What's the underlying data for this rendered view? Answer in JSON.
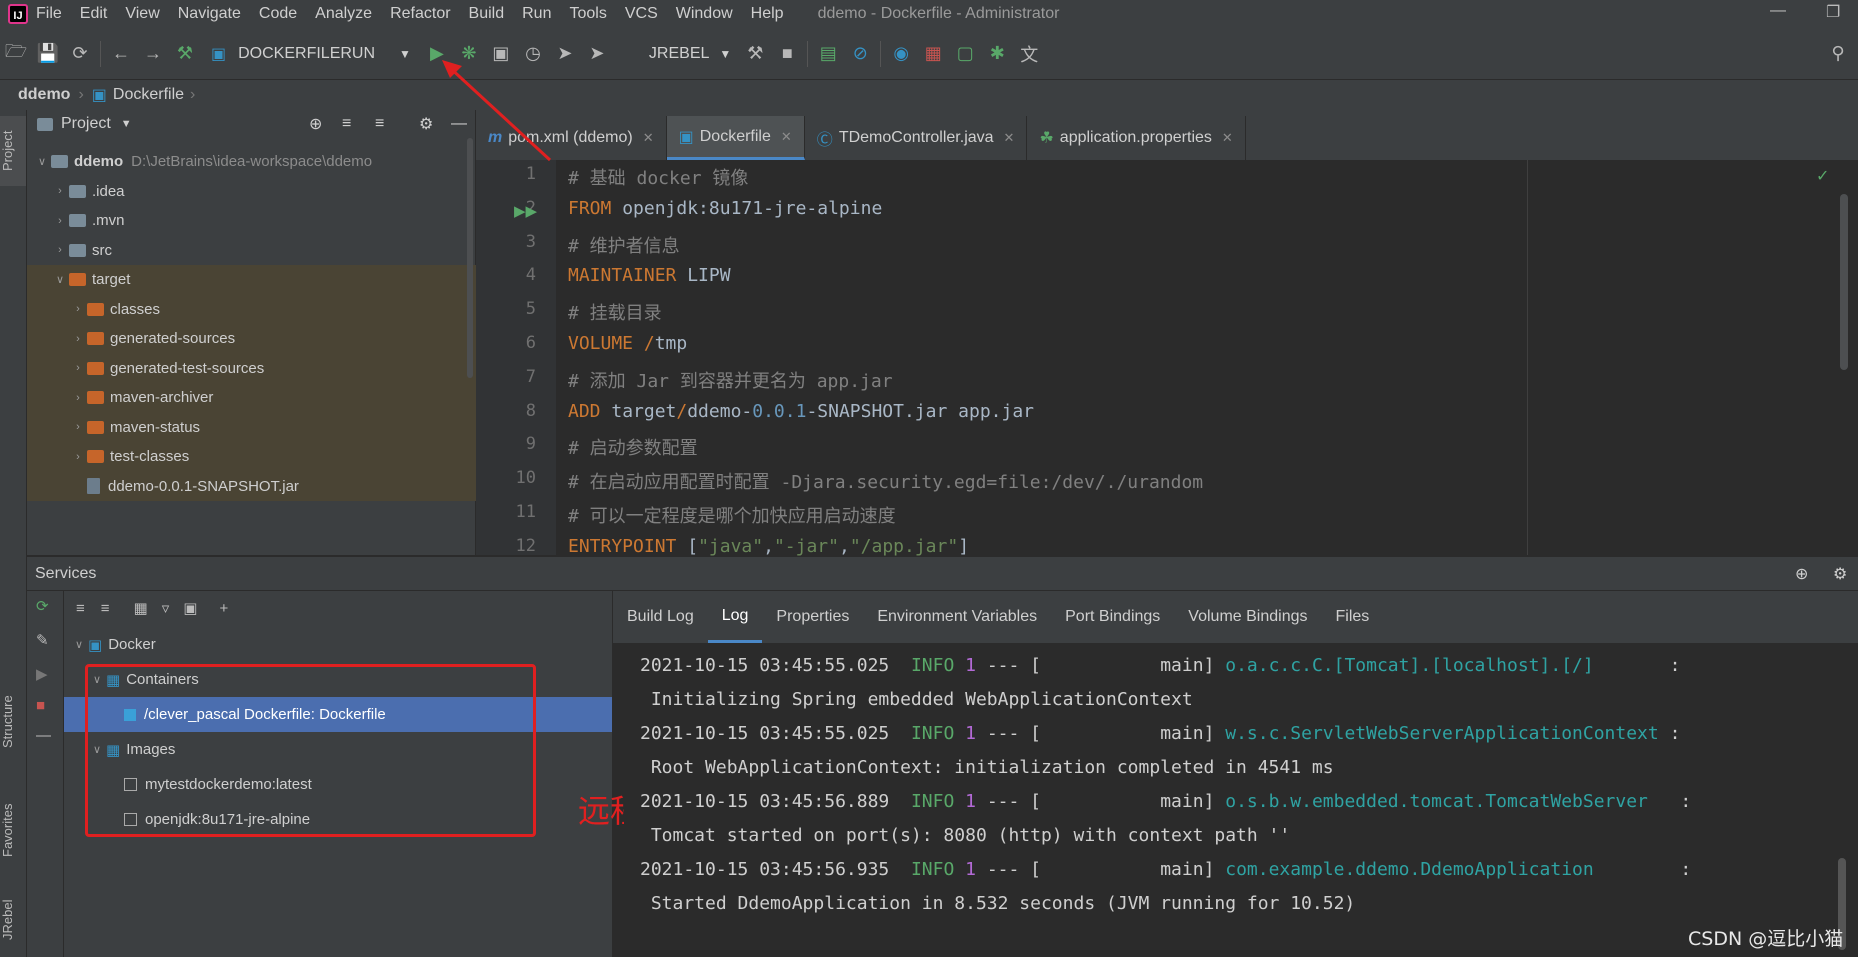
{
  "menubar": {
    "items": [
      "File",
      "Edit",
      "View",
      "Navigate",
      "Code",
      "Analyze",
      "Refactor",
      "Build",
      "Run",
      "Tools",
      "VCS",
      "Window",
      "Help"
    ],
    "window_title": "ddemo - Dockerfile - Administrator"
  },
  "toolbar": {
    "run_config": "DOCKERFILERUN",
    "jrebel_config": "JREBEL"
  },
  "breadcrumb": {
    "project": "ddemo",
    "file": "Dockerfile"
  },
  "left_strip": {
    "project_tab": "Project",
    "structure_tab": "Structure",
    "favorites_tab": "Favorites",
    "jrebel_tab": "JRebel"
  },
  "project": {
    "header": "Project",
    "tree": [
      {
        "label": "ddemo",
        "path": "D:\\JetBrains\\idea-workspace\\ddemo",
        "depth": 0,
        "arrow": "v",
        "kind": "root"
      },
      {
        "label": ".idea",
        "depth": 1,
        "arrow": ">",
        "kind": "folder"
      },
      {
        "label": ".mvn",
        "depth": 1,
        "arrow": ">",
        "kind": "folder"
      },
      {
        "label": "src",
        "depth": 1,
        "arrow": ">",
        "kind": "folder"
      },
      {
        "label": "target",
        "depth": 1,
        "arrow": "v",
        "kind": "orange"
      },
      {
        "label": "classes",
        "depth": 2,
        "arrow": ">",
        "kind": "orange"
      },
      {
        "label": "generated-sources",
        "depth": 2,
        "arrow": ">",
        "kind": "orange"
      },
      {
        "label": "generated-test-sources",
        "depth": 2,
        "arrow": ">",
        "kind": "orange"
      },
      {
        "label": "maven-archiver",
        "depth": 2,
        "arrow": ">",
        "kind": "orange"
      },
      {
        "label": "maven-status",
        "depth": 2,
        "arrow": ">",
        "kind": "orange"
      },
      {
        "label": "test-classes",
        "depth": 2,
        "arrow": ">",
        "kind": "orange"
      },
      {
        "label": "ddemo-0.0.1-SNAPSHOT.jar",
        "depth": 2,
        "arrow": "",
        "kind": "jar"
      }
    ]
  },
  "editor": {
    "tabs": [
      {
        "label": "pom.xml (ddemo)",
        "icon": "m",
        "active": false
      },
      {
        "label": "Dockerfile",
        "icon": "docker",
        "active": true
      },
      {
        "label": "TDemoController.java",
        "icon": "C",
        "active": false
      },
      {
        "label": "application.properties",
        "icon": "leaf",
        "active": false
      }
    ],
    "line_numbers": [
      "1",
      "2",
      "3",
      "4",
      "5",
      "6",
      "7",
      "8",
      "9",
      "10",
      "11",
      "12"
    ],
    "code": [
      [
        {
          "t": "# 基础 docker 镜像",
          "c": "c-cmt"
        }
      ],
      [
        {
          "t": "FROM",
          "c": "c-kw"
        },
        {
          "t": " openjdk:8u171-jre-alpine",
          "c": ""
        }
      ],
      [
        {
          "t": "# 维护者信息",
          "c": "c-cmt"
        }
      ],
      [
        {
          "t": "MAINTAINER",
          "c": "c-kw"
        },
        {
          "t": " LIPW",
          "c": ""
        }
      ],
      [
        {
          "t": "# 挂载目录",
          "c": "c-cmt"
        }
      ],
      [
        {
          "t": "VOLUME",
          "c": "c-kw"
        },
        {
          "t": " ",
          "c": ""
        },
        {
          "t": "/",
          "c": "c-kw"
        },
        {
          "t": "tmp",
          "c": ""
        }
      ],
      [
        {
          "t": "# 添加 Jar 到容器并更名为 app.jar",
          "c": "c-cmt"
        }
      ],
      [
        {
          "t": "ADD",
          "c": "c-kw"
        },
        {
          "t": " target",
          "c": ""
        },
        {
          "t": "/",
          "c": "c-kw"
        },
        {
          "t": "ddemo-",
          "c": ""
        },
        {
          "t": "0.0.1",
          "c": "c-num"
        },
        {
          "t": "-SNAPSHOT.jar app.jar",
          "c": ""
        }
      ],
      [
        {
          "t": "# 启动参数配置",
          "c": "c-cmt"
        }
      ],
      [
        {
          "t": "# 在启动应用配置时配置 -Djara.security.egd=file:/dev/./urandom",
          "c": "c-cmt"
        }
      ],
      [
        {
          "t": "# 可以一定程度是哪个加快应用启动速度",
          "c": "c-cmt"
        }
      ],
      [
        {
          "t": "ENTRYPOINT",
          "c": "c-kw"
        },
        {
          "t": " [",
          "c": ""
        },
        {
          "t": "\"java\"",
          "c": "c-str"
        },
        {
          "t": ",",
          "c": ""
        },
        {
          "t": "\"-jar\"",
          "c": "c-str"
        },
        {
          "t": ",",
          "c": ""
        },
        {
          "t": "\"/app.jar\"",
          "c": "c-str"
        },
        {
          "t": "]",
          "c": ""
        }
      ]
    ]
  },
  "services": {
    "title": "Services",
    "tree": [
      {
        "label": "Docker",
        "depth": 0,
        "arrow": "v",
        "icon": "docker",
        "selected": false
      },
      {
        "label": "Containers",
        "depth": 1,
        "arrow": "v",
        "icon": "grid",
        "selected": false
      },
      {
        "label": "/clever_pascal Dockerfile: Dockerfile",
        "depth": 2,
        "arrow": "",
        "icon": "container",
        "selected": true
      },
      {
        "label": "Images",
        "depth": 1,
        "arrow": "v",
        "icon": "grid",
        "selected": false
      },
      {
        "label": "mytestdockerdemo:latest",
        "depth": 2,
        "arrow": "",
        "icon": "box",
        "selected": false
      },
      {
        "label": "openjdk:8u171-jre-alpine",
        "depth": 2,
        "arrow": "",
        "icon": "box",
        "selected": false
      }
    ],
    "annotation": "远程docker信息",
    "log_tabs": [
      {
        "label": "Build Log",
        "active": false
      },
      {
        "label": "Log",
        "active": true
      },
      {
        "label": "Properties",
        "active": false
      },
      {
        "label": "Environment Variables",
        "active": false
      },
      {
        "label": "Port Bindings",
        "active": false
      },
      {
        "label": "Volume Bindings",
        "active": false
      },
      {
        "label": "Files",
        "active": false
      }
    ],
    "log_lines": [
      {
        "ts": "2021-10-15 03:45:55.025",
        "level": "INFO",
        "pid": "1",
        "thread": "--- [           main]",
        "cls": "o.a.c.c.C.[Tomcat].[localhost].[/]      ",
        "tail": " :"
      },
      {
        "msg": " Initializing Spring embedded WebApplicationContext"
      },
      {
        "ts": "2021-10-15 03:45:55.025",
        "level": "INFO",
        "pid": "1",
        "thread": "--- [           main]",
        "cls": "w.s.c.ServletWebServerApplicationContext",
        "tail": " :"
      },
      {
        "msg": " Root WebApplicationContext: initialization completed in 4541 ms"
      },
      {
        "ts": "2021-10-15 03:45:56.889",
        "level": "INFO",
        "pid": "1",
        "thread": "--- [           main]",
        "cls": "o.s.b.w.embedded.tomcat.TomcatWebServer  ",
        "tail": " :"
      },
      {
        "msg": " Tomcat started on port(s): 8080 (http) with context path ''"
      },
      {
        "ts": "2021-10-15 03:45:56.935",
        "level": "INFO",
        "pid": "1",
        "thread": "--- [           main]",
        "cls": "com.example.ddemo.DdemoApplication       ",
        "tail": " :"
      },
      {
        "msg": " Started DdemoApplication in 8.532 seconds (JVM running for 10.52)"
      }
    ]
  },
  "watermark": "CSDN @逗比小猫"
}
